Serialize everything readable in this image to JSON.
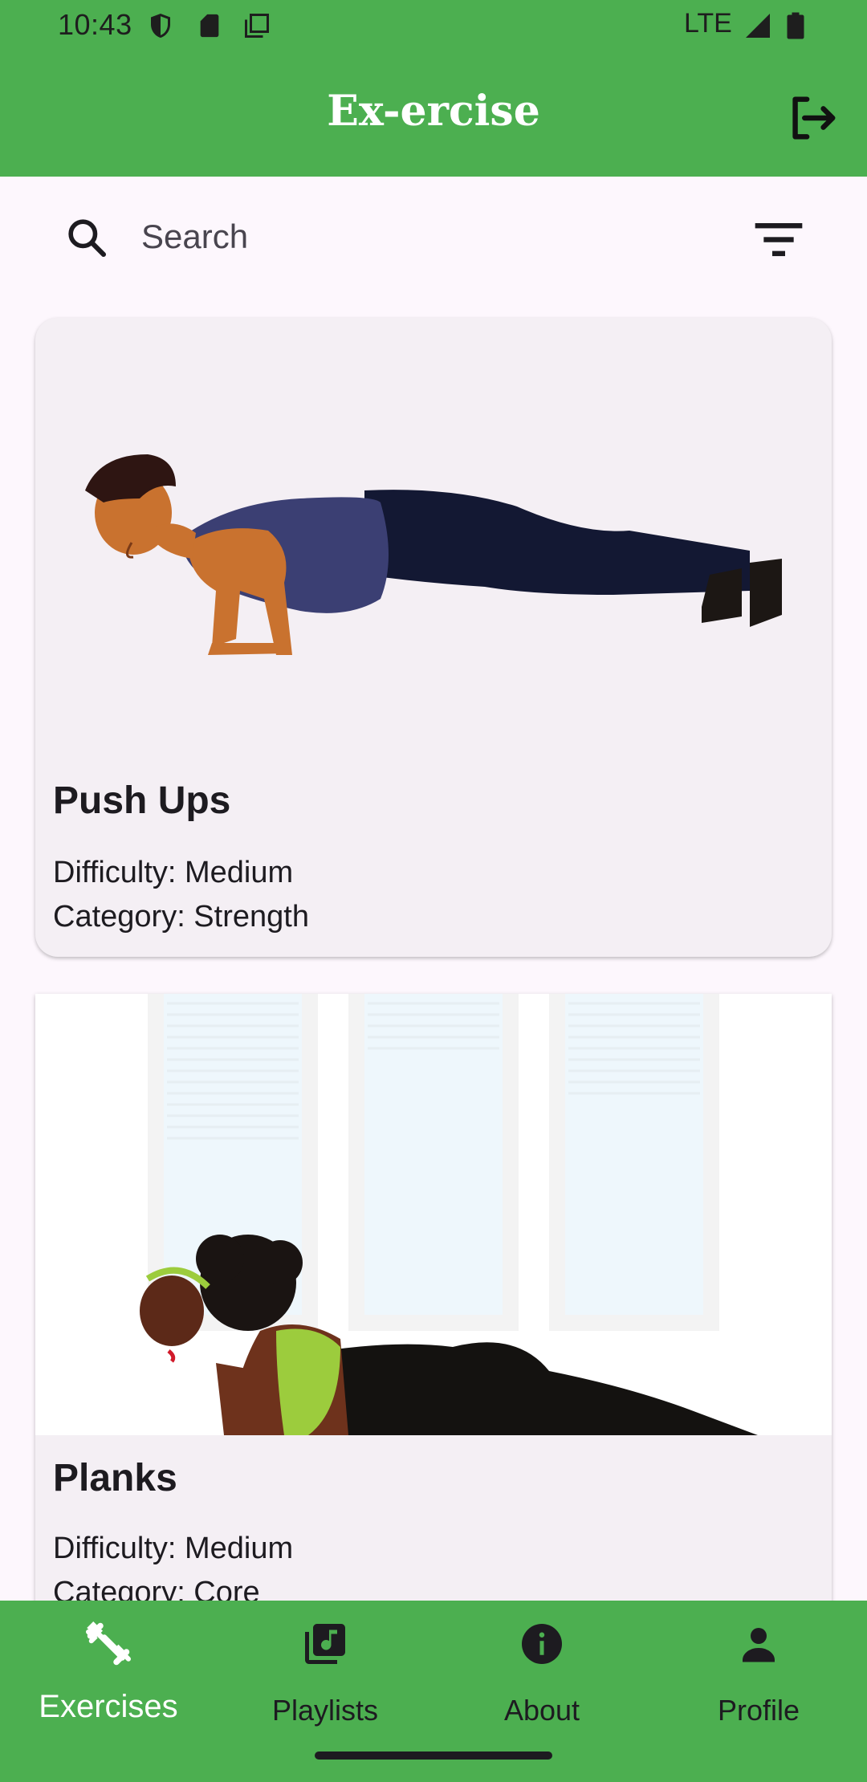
{
  "status_bar": {
    "time": "10:43",
    "network": "LTE"
  },
  "app_bar": {
    "title": "Ex-ercise"
  },
  "search": {
    "placeholder": "Search",
    "value": ""
  },
  "exercises": [
    {
      "name": "Push Ups",
      "difficulty": "Difficulty: Medium",
      "category": "Category: Strength"
    },
    {
      "name": "Planks",
      "difficulty": "Difficulty: Medium",
      "category": "Category: Core"
    }
  ],
  "bottom_nav": {
    "items": [
      {
        "label": "Exercises",
        "icon": "dumbbell-icon",
        "active": true
      },
      {
        "label": "Playlists",
        "icon": "music-library-icon",
        "active": false
      },
      {
        "label": "About",
        "icon": "info-icon",
        "active": false
      },
      {
        "label": "Profile",
        "icon": "person-icon",
        "active": false
      }
    ]
  },
  "colors": {
    "primary": "#4caf50",
    "background": "#fdf7fd",
    "card": "#f4eff4",
    "text": "#1d1b20"
  }
}
